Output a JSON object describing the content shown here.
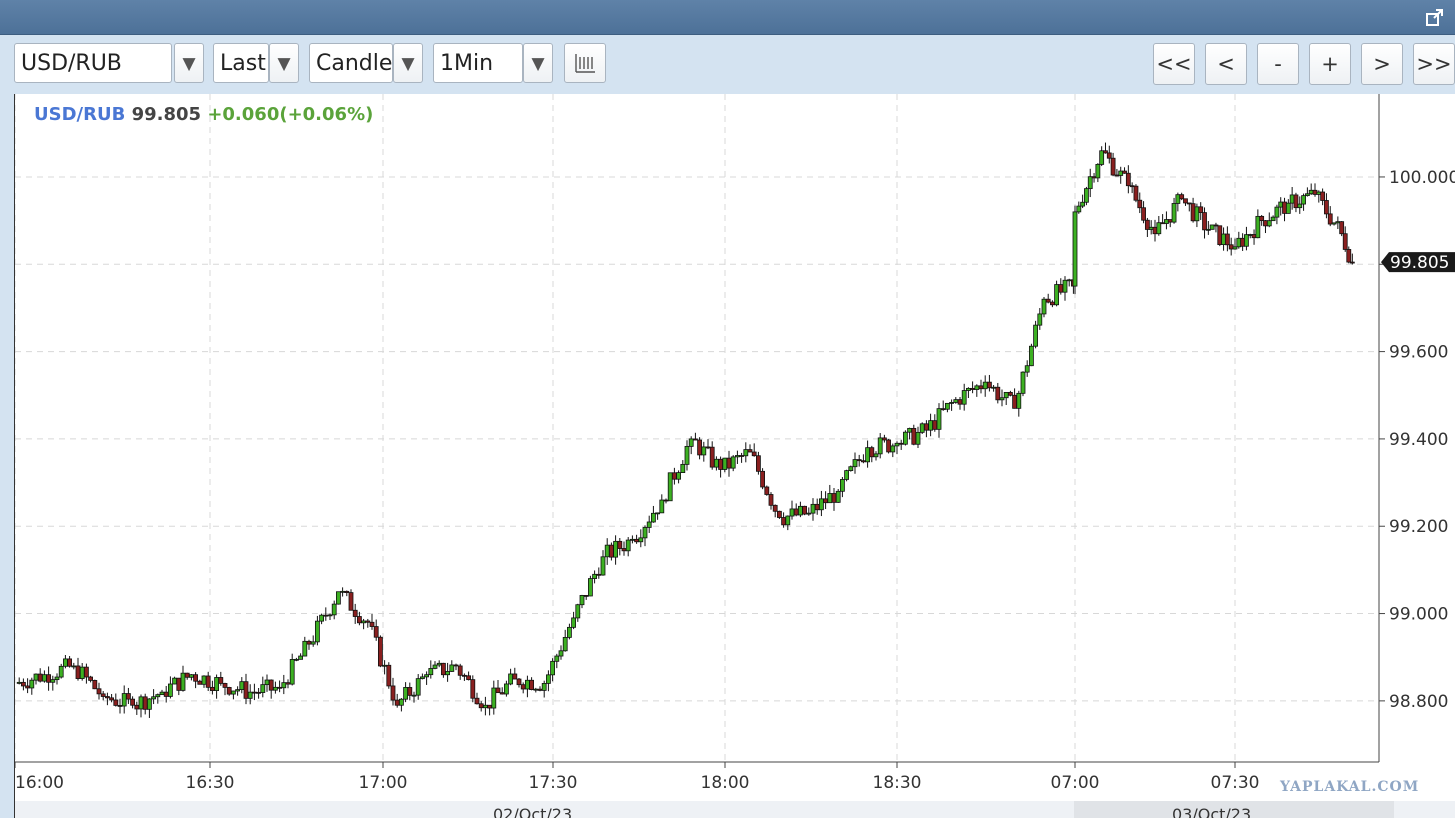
{
  "toolbar": {
    "symbol": "USD/RUB",
    "price_field": "Last",
    "chart_style": "Candle",
    "interval": "1Min",
    "dropdown_arrow": "▼",
    "nav": [
      "<<",
      "<",
      "-",
      "+",
      ">",
      ">>"
    ]
  },
  "legend": {
    "symbol": "USD/RUB",
    "price": "99.805",
    "change": "+0.060(+0.06%)"
  },
  "dates": [
    "02/Oct/23",
    "03/Oct/23"
  ],
  "watermark": "YAPLAKAL.COM",
  "icons": {
    "expand": "expand-icon",
    "chart_settings": "columns-icon"
  },
  "colors": {
    "titlebar": "#4f7399",
    "toolbar": "#d4e3f1",
    "up_candle": "#3cb022",
    "down_candle": "#8a1f1f",
    "legend_symbol": "#4a77d4",
    "legend_change": "#5aa33a"
  },
  "chart_data": {
    "type": "candlestick",
    "title": "",
    "xlabel": "",
    "ylabel": "",
    "x_ticks": [
      "16:00",
      "16:30",
      "17:00",
      "17:30",
      "18:00",
      "18:30",
      "07:00",
      "07:30"
    ],
    "y_ticks": [
      98.8,
      99.0,
      99.2,
      99.4,
      99.6,
      99.8,
      100.0
    ],
    "y_tick_labels": [
      "98.800",
      "99.000",
      "99.200",
      "99.400",
      "99.600",
      "99.800",
      "100.000"
    ],
    "ylim": [
      98.66,
      100.19
    ],
    "last_price_label": "99.805",
    "grid": true,
    "close_path": [
      [
        "16:00",
        98.84
      ],
      [
        "16:05",
        98.86
      ],
      [
        "16:10",
        98.88
      ],
      [
        "16:15",
        98.81
      ],
      [
        "16:20",
        98.79
      ],
      [
        "16:25",
        98.82
      ],
      [
        "16:30",
        98.86
      ],
      [
        "16:35",
        98.84
      ],
      [
        "16:40",
        98.82
      ],
      [
        "16:45",
        98.83
      ],
      [
        "16:50",
        98.93
      ],
      [
        "16:55",
        99.05
      ],
      [
        "17:00",
        98.98
      ],
      [
        "17:05",
        98.79
      ],
      [
        "17:10",
        98.86
      ],
      [
        "17:15",
        98.88
      ],
      [
        "17:20",
        98.79
      ],
      [
        "17:25",
        98.85
      ],
      [
        "17:30",
        98.84
      ],
      [
        "17:35",
        98.99
      ],
      [
        "17:40",
        99.13
      ],
      [
        "17:45",
        99.17
      ],
      [
        "17:50",
        99.26
      ],
      [
        "17:55",
        99.4
      ],
      [
        "18:00",
        99.33
      ],
      [
        "18:05",
        99.37
      ],
      [
        "18:10",
        99.22
      ],
      [
        "18:15",
        99.23
      ],
      [
        "18:20",
        99.28
      ],
      [
        "18:25",
        99.38
      ],
      [
        "18:30",
        99.39
      ],
      [
        "18:35",
        99.42
      ],
      [
        "18:40",
        99.49
      ],
      [
        "18:45",
        99.53
      ],
      [
        "18:50",
        99.47
      ],
      [
        "18:55",
        99.72
      ],
      [
        "19:00",
        99.75
      ],
      [
        "07:00",
        99.92
      ],
      [
        "07:05",
        100.06
      ],
      [
        "07:10",
        99.98
      ],
      [
        "07:15",
        99.87
      ],
      [
        "07:20",
        99.95
      ],
      [
        "07:25",
        99.88
      ],
      [
        "07:30",
        99.84
      ],
      [
        "07:35",
        99.9
      ],
      [
        "07:40",
        99.94
      ],
      [
        "07:45",
        99.96
      ],
      [
        "07:50",
        99.87
      ],
      [
        "07:52",
        99.805
      ]
    ]
  }
}
